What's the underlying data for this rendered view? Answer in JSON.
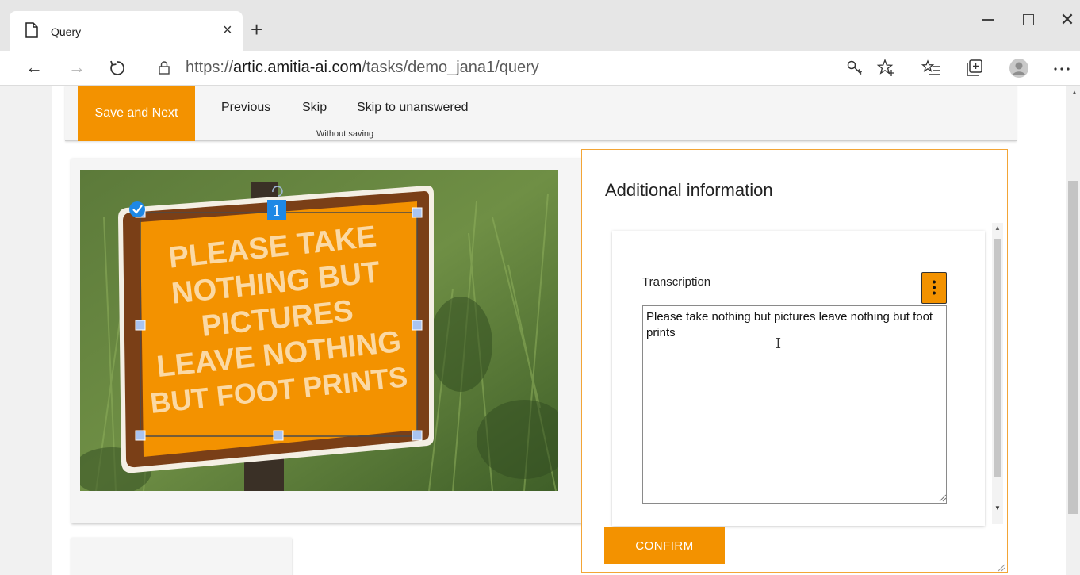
{
  "browser": {
    "tab_title": "Query",
    "tab_close": "×",
    "new_tab": "+",
    "window_close": "✕",
    "url_prefix": "https://",
    "url_domain": "artic.amitia-ai.com",
    "url_path": "/tasks/demo_jana1/query",
    "icons": [
      "page-icon",
      "back-icon",
      "forward-icon",
      "refresh-icon",
      "lock-icon",
      "key-icon",
      "favorite-star-icon",
      "favorites-list-icon",
      "collections-icon",
      "profile-avatar",
      "more-icon"
    ]
  },
  "toolbar": {
    "save_next_label": "Save and Next",
    "previous_label": "Previous",
    "skip_label": "Skip",
    "skip_unanswered_label": "Skip to unanswered",
    "skip_sublabel": "Without saving"
  },
  "image": {
    "box_number": "1",
    "sign_text": [
      "PLEASE TAKE",
      "NOTHING BUT",
      "PICTURES",
      "LEAVE NOTHING",
      "BUT FOOT PRINTS"
    ],
    "sign_color": "#f39200"
  },
  "info": {
    "title": "Additional information",
    "field_label": "Transcription",
    "transcription": "Please take nothing but pictures leave nothing but foot prints",
    "confirm_label": "CONFIRM"
  },
  "colors": {
    "accent": "#f39200",
    "panel_border": "#f3a536",
    "selection_blue": "#1e88e5"
  }
}
